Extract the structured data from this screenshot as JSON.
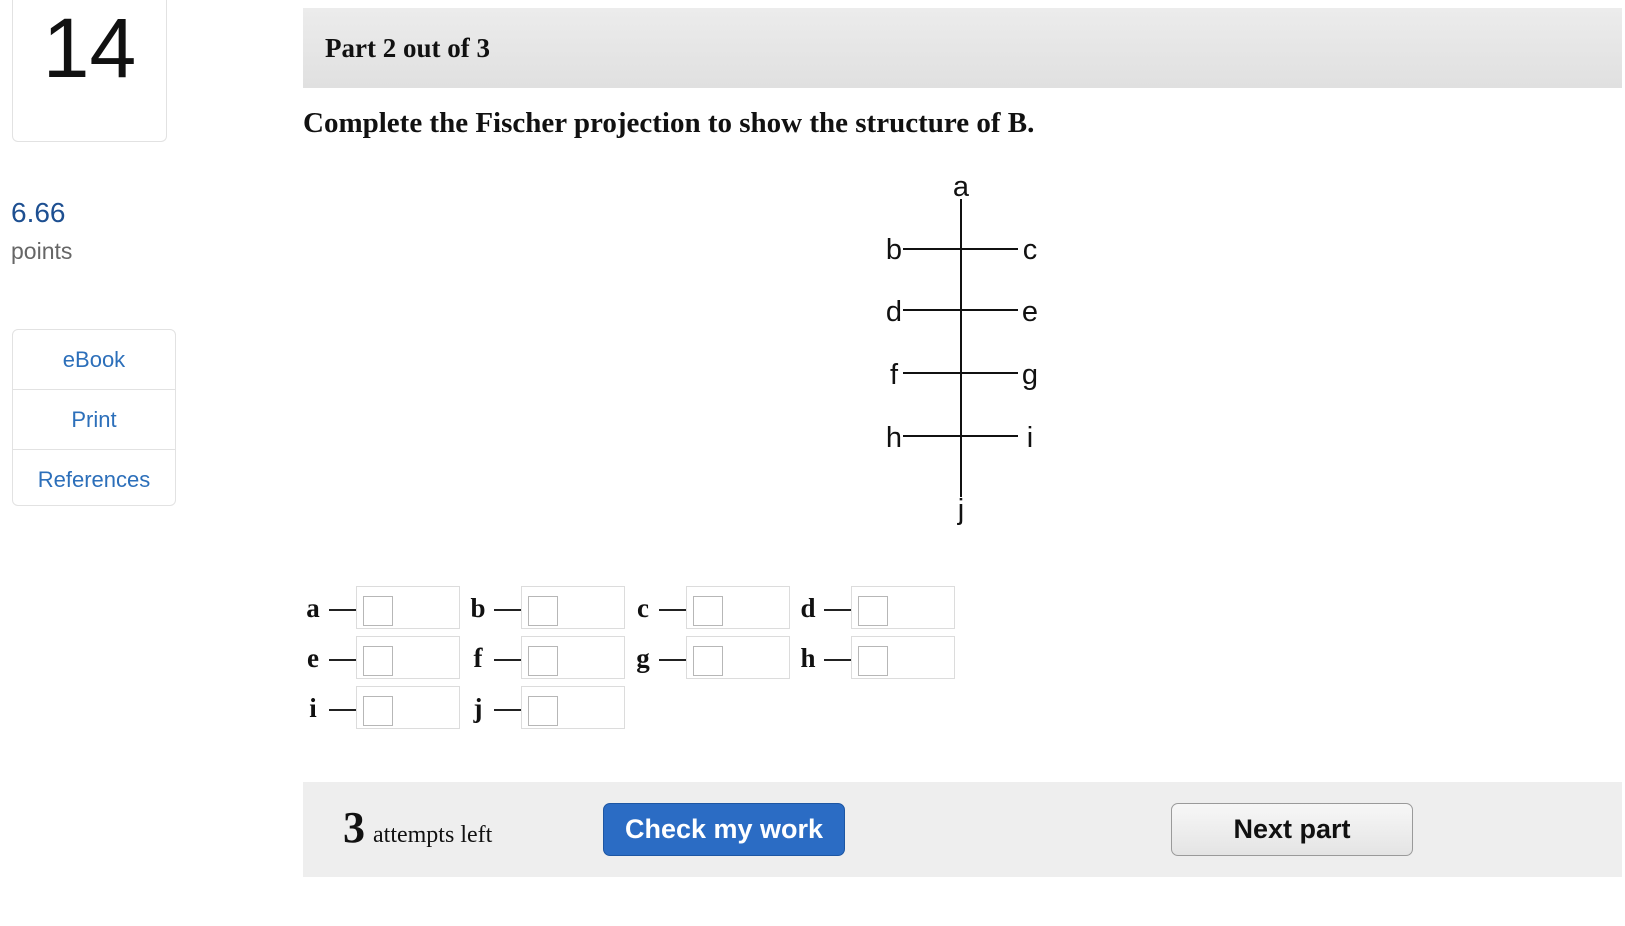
{
  "question": {
    "number": "14",
    "points_value": "6.66",
    "points_label": "points"
  },
  "resources": {
    "items": [
      "eBook",
      "Print",
      "References"
    ]
  },
  "part": {
    "header": "Part 2 out of 3",
    "prompt": "Complete the Fischer projection to show the structure of B."
  },
  "fischer": {
    "top": "a",
    "bottom": "j",
    "rows": [
      {
        "left": "b",
        "right": "c"
      },
      {
        "left": "d",
        "right": "e"
      },
      {
        "left": "f",
        "right": "g"
      },
      {
        "left": "h",
        "right": "i"
      }
    ]
  },
  "answers": {
    "rows": [
      [
        {
          "letter": "a",
          "value": ""
        },
        {
          "letter": "b",
          "value": ""
        },
        {
          "letter": "c",
          "value": ""
        },
        {
          "letter": "d",
          "value": ""
        }
      ],
      [
        {
          "letter": "e",
          "value": ""
        },
        {
          "letter": "f",
          "value": ""
        },
        {
          "letter": "g",
          "value": ""
        },
        {
          "letter": "h",
          "value": ""
        }
      ],
      [
        {
          "letter": "i",
          "value": ""
        },
        {
          "letter": "j",
          "value": ""
        }
      ]
    ]
  },
  "footer": {
    "attempts_count": "3",
    "attempts_label": "attempts left",
    "check_label": "Check my work",
    "next_label": "Next part"
  }
}
